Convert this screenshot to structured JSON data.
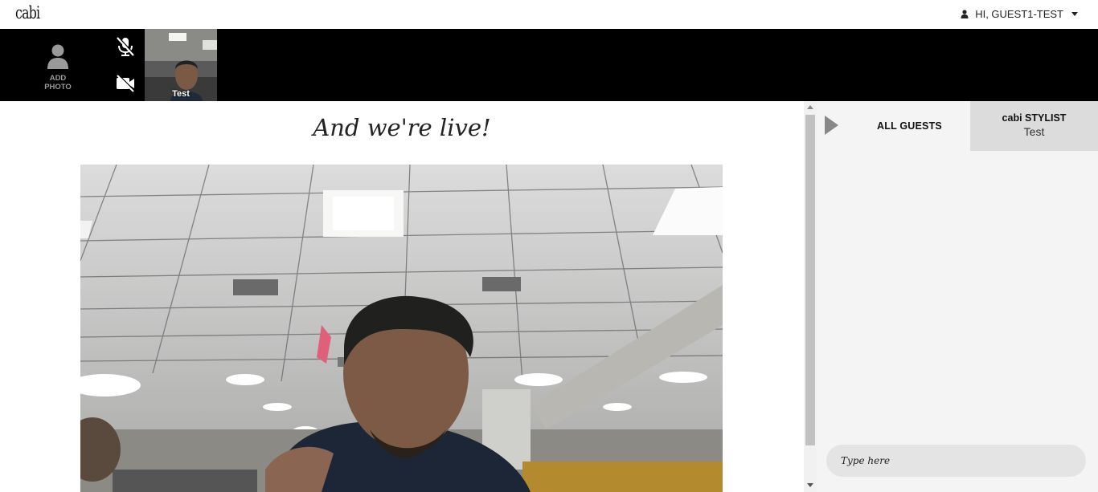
{
  "header": {
    "logo": "cabi",
    "user_greeting": "HI, GUEST1-TEST"
  },
  "strip": {
    "add_photo_label_1": "ADD",
    "add_photo_label_2": "PHOTO",
    "thumbnail_name": "Test"
  },
  "main": {
    "title": "And we're live!"
  },
  "chat": {
    "tab_all_guests": "ALL GUESTS",
    "tab_stylist_title": "cabi STYLIST",
    "tab_stylist_name": "Test",
    "input_placeholder": "Type here"
  },
  "colors": {
    "strip_bg": "#000000",
    "chat_bg": "#f4f4f4",
    "active_tab_bg": "#dcdcdc",
    "input_bg": "#e4e4e4"
  }
}
